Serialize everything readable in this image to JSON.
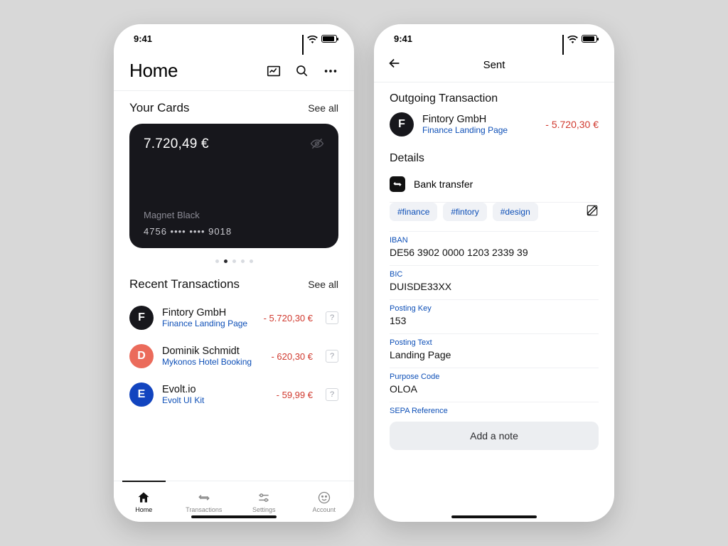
{
  "status": {
    "time": "9:41"
  },
  "home": {
    "title": "Home",
    "your_cards_label": "Your Cards",
    "see_all": "See all",
    "card": {
      "balance": "7.720,49 €",
      "name": "Magnet Black",
      "number": "4756   ••••  ••••   9018"
    },
    "recent_label": "Recent Transactions",
    "transactions": [
      {
        "initial": "F",
        "name": "Fintory GmbH",
        "sub": "Finance Landing Page",
        "amount": "- 5.720,30 €"
      },
      {
        "initial": "D",
        "name": "Dominik Schmidt",
        "sub": "Mykonos Hotel Booking",
        "amount": "- 620,30 €"
      },
      {
        "initial": "E",
        "name": "Evolt.io",
        "sub": "Evolt UI Kit",
        "amount": "- 59,99 €"
      }
    ],
    "tabs": {
      "home": "Home",
      "transactions": "Transactions",
      "settings": "Settings",
      "account": "Account"
    }
  },
  "detail": {
    "screen_title": "Sent",
    "section_outgoing": "Outgoing Transaction",
    "tx": {
      "initial": "F",
      "name": "Fintory GmbH",
      "sub": "Finance Landing Page",
      "amount": "- 5.720,30 €"
    },
    "details_label": "Details",
    "transfer_type": "Bank transfer",
    "tags": [
      "#finance",
      "#fintory",
      "#design"
    ],
    "fields": {
      "iban_label": "IBAN",
      "iban": "DE56 3902 0000 1203 2339 39",
      "bic_label": "BIC",
      "bic": "DUISDE33XX",
      "posting_key_label": "Posting Key",
      "posting_key": "153",
      "posting_text_label": "Posting Text",
      "posting_text": "Landing Page",
      "purpose_label": "Purpose Code",
      "purpose": "OLOA",
      "sepa_label": "SEPA Reference"
    },
    "add_note": "Add a note"
  }
}
